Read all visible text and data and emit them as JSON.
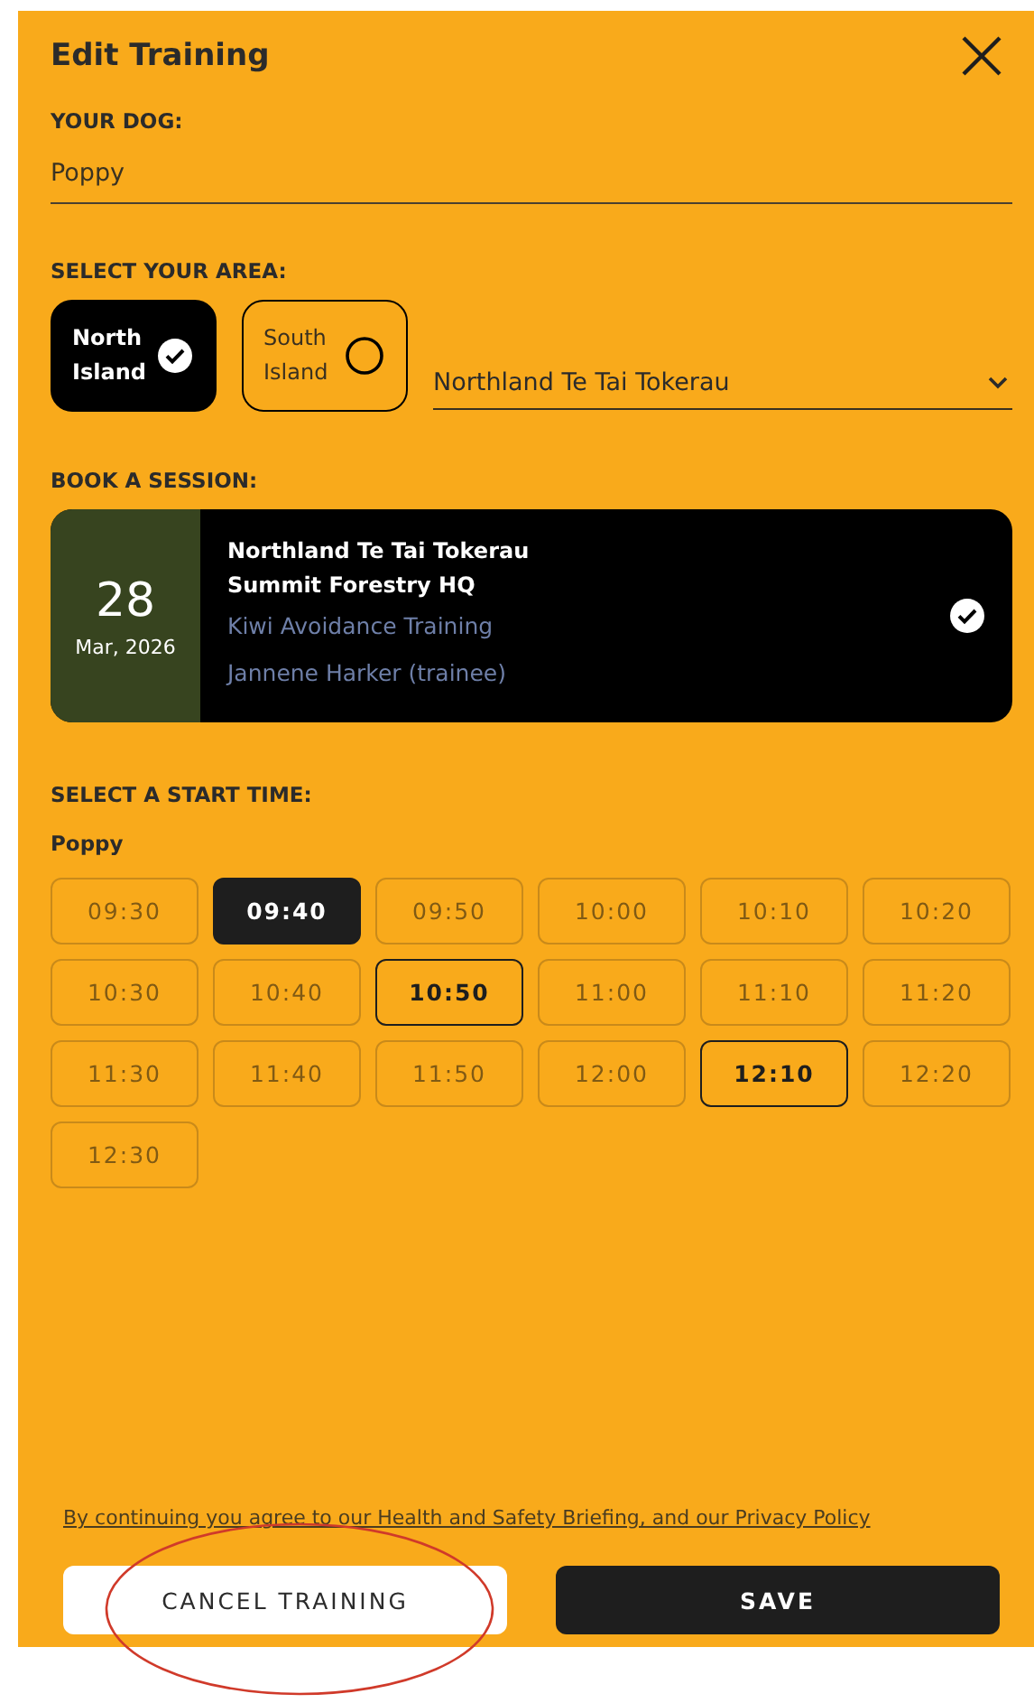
{
  "title": "Edit Training",
  "dog": {
    "label": "YOUR DOG:",
    "value": "Poppy"
  },
  "area": {
    "label": "SELECT YOUR AREA:",
    "options": [
      {
        "label": "North Island",
        "selected": true
      },
      {
        "label": "South Island",
        "selected": false
      }
    ],
    "region": "Northland Te Tai Tokerau"
  },
  "session": {
    "label": "BOOK A SESSION:",
    "day": "28",
    "month": "Mar, 2026",
    "region": "Northland Te Tai Tokerau",
    "venue": "Summit Forestry HQ",
    "course": "Kiwi Avoidance Training",
    "trainer": "Jannene Harker (trainee)",
    "selected": true
  },
  "times": {
    "label": "SELECT A START TIME:",
    "dog": "Poppy",
    "slots": [
      {
        "time": "09:30",
        "selected": false,
        "disabled": true
      },
      {
        "time": "09:40",
        "selected": true,
        "disabled": false
      },
      {
        "time": "09:50",
        "selected": false,
        "disabled": true
      },
      {
        "time": "10:00",
        "selected": false,
        "disabled": true
      },
      {
        "time": "10:10",
        "selected": false,
        "disabled": true
      },
      {
        "time": "10:20",
        "selected": false,
        "disabled": true
      },
      {
        "time": "10:30",
        "selected": false,
        "disabled": true
      },
      {
        "time": "10:40",
        "selected": false,
        "disabled": true
      },
      {
        "time": "10:50",
        "selected": false,
        "disabled": false
      },
      {
        "time": "11:00",
        "selected": false,
        "disabled": true
      },
      {
        "time": "11:10",
        "selected": false,
        "disabled": true
      },
      {
        "time": "11:20",
        "selected": false,
        "disabled": true
      },
      {
        "time": "11:30",
        "selected": false,
        "disabled": true
      },
      {
        "time": "11:40",
        "selected": false,
        "disabled": true
      },
      {
        "time": "11:50",
        "selected": false,
        "disabled": true
      },
      {
        "time": "12:00",
        "selected": false,
        "disabled": true
      },
      {
        "time": "12:10",
        "selected": false,
        "disabled": false
      },
      {
        "time": "12:20",
        "selected": false,
        "disabled": true
      },
      {
        "time": "12:30",
        "selected": false,
        "disabled": true
      }
    ]
  },
  "agreement": "By continuing you agree to our Health and Safety Briefing, and our Privacy Policy",
  "buttons": [
    {
      "label": "CANCEL TRAINING",
      "kind": "secondary"
    },
    {
      "label": "SAVE",
      "kind": "primary"
    }
  ],
  "annotation_circle": true
}
